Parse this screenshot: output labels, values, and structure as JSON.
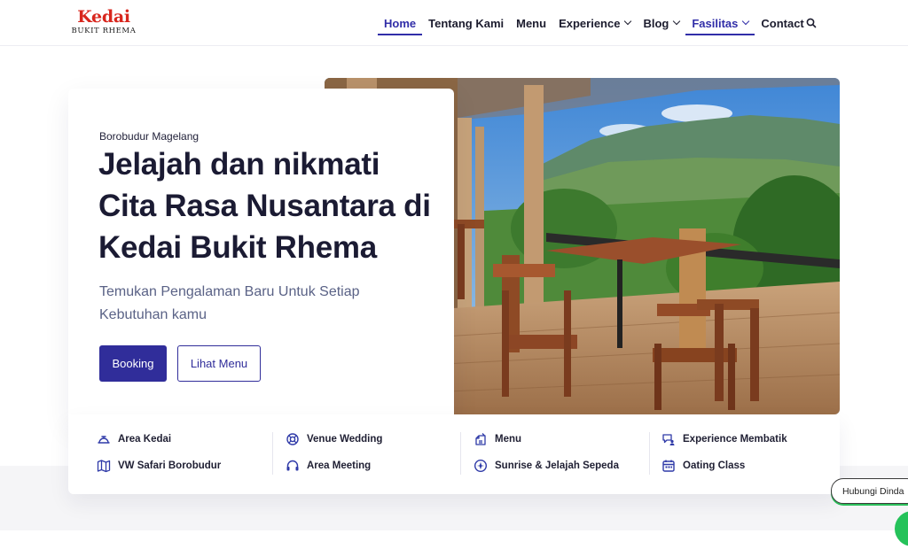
{
  "brand": {
    "name": "Kedai",
    "subname": "BUKIT RHEMA"
  },
  "nav": {
    "items": [
      {
        "label": "Home"
      },
      {
        "label": "Tentang Kami"
      },
      {
        "label": "Menu"
      },
      {
        "label": "Experience"
      },
      {
        "label": "Blog"
      },
      {
        "label": "Fasilitas"
      },
      {
        "label": "Contact"
      }
    ]
  },
  "hero": {
    "subtitle": "Borobudur Magelang",
    "headline": "Jelajah dan nikmati Cita Rasa Nusantara di Kedai Bukit Rhema",
    "tagline": "Temukan Pengalaman Baru Untuk Setiap Kebutuhan kamu",
    "booking_label": "Booking",
    "menu_label": "Lihat Menu"
  },
  "facilities": [
    {
      "label": "Area Kedai",
      "icon": "cloche-icon"
    },
    {
      "label": "VW Safari Borobudur",
      "icon": "map-icon"
    },
    {
      "label": "Venue Wedding",
      "icon": "rings-icon"
    },
    {
      "label": "Area Meeting",
      "icon": "headset-icon"
    },
    {
      "label": "Menu",
      "icon": "menu-book-icon"
    },
    {
      "label": "Sunrise & Jelajah Sepeda",
      "icon": "compass-icon"
    },
    {
      "label": "Experience Membatik",
      "icon": "chat-user-icon"
    },
    {
      "label": "Oating Class",
      "icon": "calendar-icon"
    }
  ],
  "contact": {
    "hubungi_label": "Hubungi Dinda",
    "whatsapp_icon": "whatsapp-icon"
  },
  "colors": {
    "brand_red": "#d8261d",
    "primary": "#302d9a",
    "nav_active": "#312ea8",
    "whatsapp": "#25c25a"
  }
}
